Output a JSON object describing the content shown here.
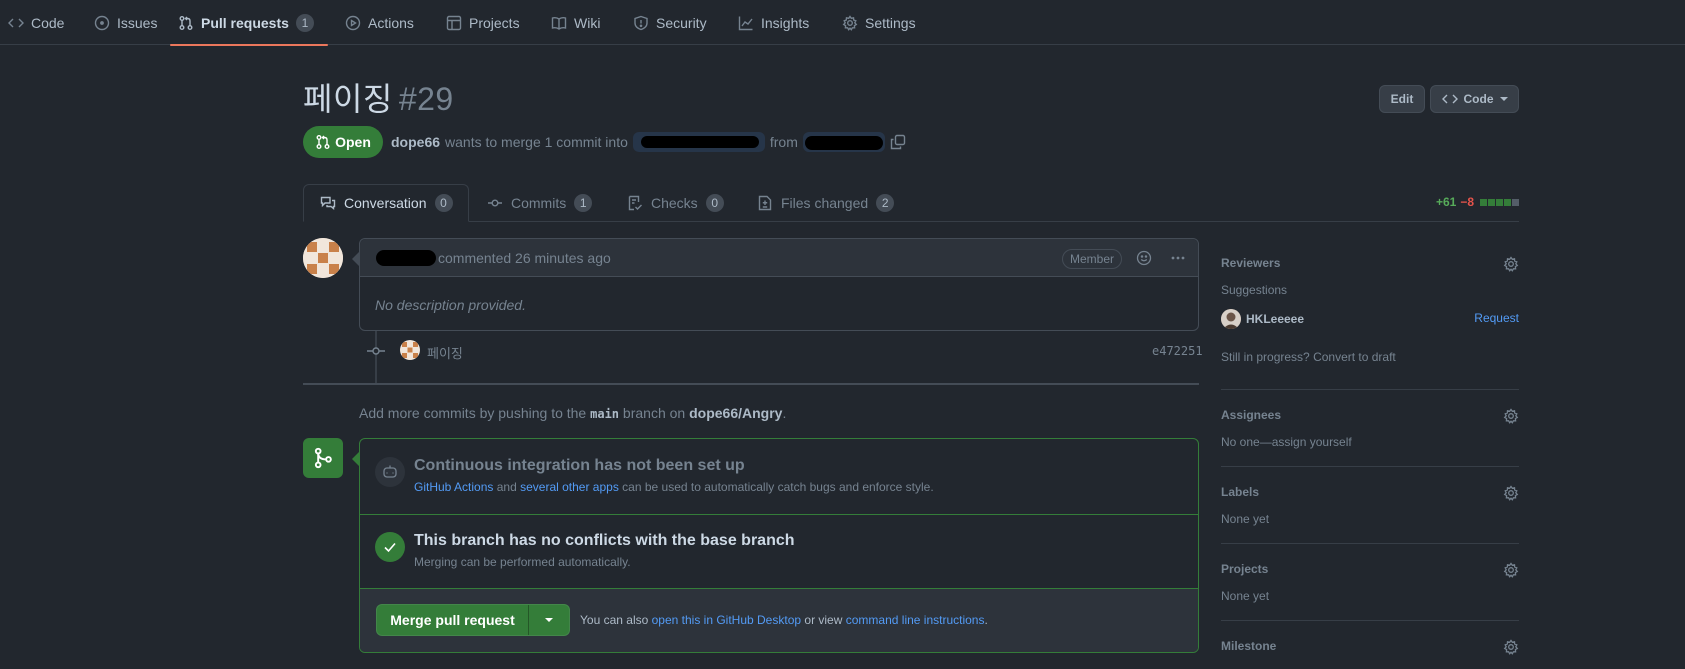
{
  "repo_nav": {
    "items": [
      {
        "label": "Code",
        "icon": "code-icon"
      },
      {
        "label": "Issues",
        "icon": "issue-icon"
      },
      {
        "label": "Pull requests",
        "icon": "pull-request-icon",
        "count": "1",
        "selected": true
      },
      {
        "label": "Actions",
        "icon": "play-icon"
      },
      {
        "label": "Projects",
        "icon": "table-icon"
      },
      {
        "label": "Wiki",
        "icon": "book-icon"
      },
      {
        "label": "Security",
        "icon": "shield-icon"
      },
      {
        "label": "Insights",
        "icon": "graph-icon"
      },
      {
        "label": "Settings",
        "icon": "gear-icon"
      }
    ]
  },
  "header": {
    "title": "페이징",
    "number": "#29",
    "edit_label": "Edit",
    "code_label": "Code",
    "state": "Open",
    "author": "dope66",
    "merge_text": "wants to merge 1 commit into",
    "from_text": "from"
  },
  "tabs": [
    {
      "label": "Conversation",
      "count": "0",
      "icon": "comment-discussion-icon"
    },
    {
      "label": "Commits",
      "count": "1",
      "icon": "commit-icon"
    },
    {
      "label": "Checks",
      "count": "0",
      "icon": "checklist-icon"
    },
    {
      "label": "Files changed",
      "count": "2",
      "icon": "file-diff-icon"
    }
  ],
  "diffstat": {
    "additions": "+61",
    "deletions": "−8"
  },
  "comment": {
    "timestamp_text": "commented 26 minutes ago",
    "role": "Member",
    "body": "No description provided."
  },
  "commit": {
    "message": "페이징",
    "sha": "e472251"
  },
  "push_hint": {
    "prefix": "Add more commits by pushing to the",
    "branch": "main",
    "middle": "branch on",
    "repo": "dope66/Angry",
    "suffix": "."
  },
  "merge_box": {
    "ci_title": "Continuous integration has not been set up",
    "ci_link1": "GitHub Actions",
    "ci_and": "and",
    "ci_link2": "several other apps",
    "ci_rest": "can be used to automatically catch bugs and enforce style.",
    "conflict_title": "This branch has no conflicts with the base branch",
    "conflict_sub": "Merging can be performed automatically.",
    "merge_button": "Merge pull request",
    "also_text": "You can also",
    "desktop_link": "open this in GitHub Desktop",
    "or_view": "or view",
    "cli_link": "command line instructions",
    "end": "."
  },
  "sidebar": {
    "reviewers_heading": "Reviewers",
    "suggestions_label": "Suggestions",
    "suggested_user": "HKLeeeee",
    "request_label": "Request",
    "draft_prefix": "Still in progress?",
    "draft_link": "Convert to draft",
    "assignees_heading": "Assignees",
    "assignees_text": "No one—assign yourself",
    "labels_heading": "Labels",
    "labels_text": "None yet",
    "projects_heading": "Projects",
    "projects_text": "None yet",
    "milestone_heading": "Milestone"
  },
  "colors": {
    "background": "#22272e",
    "accent_green": "#347d39",
    "link": "#539bf5",
    "underline": "#ec775c"
  }
}
